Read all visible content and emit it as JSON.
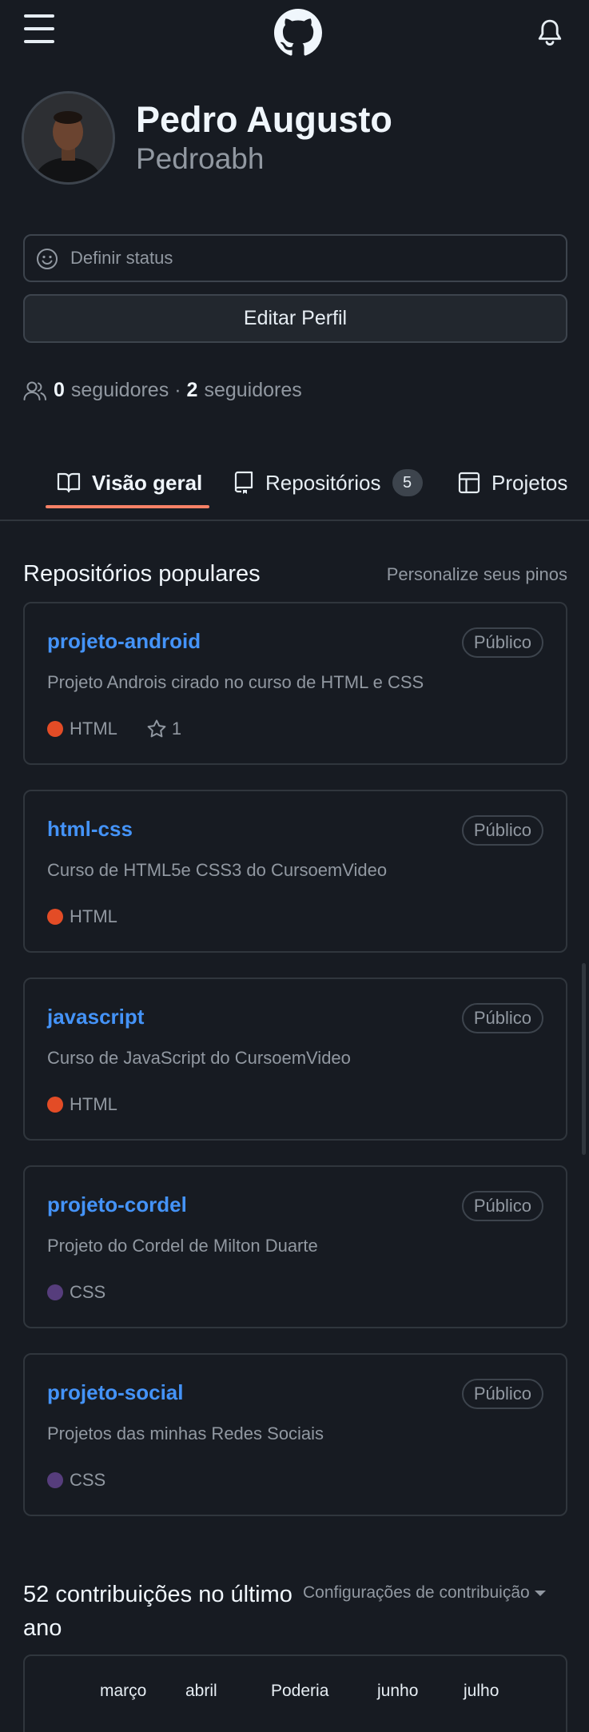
{
  "header": {
    "menu_icon": "hamburger-icon",
    "logo_icon": "github-logo-icon",
    "notifications_icon": "bell-icon"
  },
  "profile": {
    "name": "Pedro Augusto",
    "username": "Pedroabh",
    "status_placeholder": "Definir status",
    "edit_button": "Editar Perfil",
    "followers_count": "0",
    "followers_label": "seguidores",
    "separator": "·",
    "following_count": "2",
    "following_label": "seguidores"
  },
  "tabs": [
    {
      "label": "Visão geral",
      "icon": "book-icon",
      "active": true
    },
    {
      "label": "Repositórios",
      "icon": "repo-icon",
      "count": "5"
    },
    {
      "label": "Projetos",
      "icon": "table-icon"
    }
  ],
  "popular": {
    "title": "Repositórios populares",
    "customize": "Personalize seus pinos",
    "repos": [
      {
        "name": "projeto-android",
        "visibility": "Público",
        "description": "Projeto Androis cirado no curso de HTML e CSS",
        "language": "HTML",
        "language_color": "#e34c26",
        "stars": "1"
      },
      {
        "name": "html-css",
        "visibility": "Público",
        "description": "Curso de HTML5e CSS3 do CursoemVideo",
        "language": "HTML",
        "language_color": "#e34c26"
      },
      {
        "name": "javascript",
        "visibility": "Público",
        "description": "Curso de JavaScript do CursoemVideo",
        "language": "HTML",
        "language_color": "#e34c26"
      },
      {
        "name": "projeto-cordel",
        "visibility": "Público",
        "description": "Projeto do Cordel de Milton Duarte",
        "language": "CSS",
        "language_color": "#563d7c"
      },
      {
        "name": "projeto-social",
        "visibility": "Público",
        "description": "Projetos das minhas Redes Sociais",
        "language": "CSS",
        "language_color": "#563d7c"
      }
    ]
  },
  "contributions": {
    "title": "52 contribuições no último ano",
    "settings": "Configurações de contribuição",
    "months": [
      "março",
      "abril",
      "Poderia",
      "junho",
      "julho"
    ]
  },
  "colors": {
    "background": "#171b22",
    "link": "#4493f8",
    "tab_accent": "#f78166",
    "muted_text": "#9198a1"
  }
}
